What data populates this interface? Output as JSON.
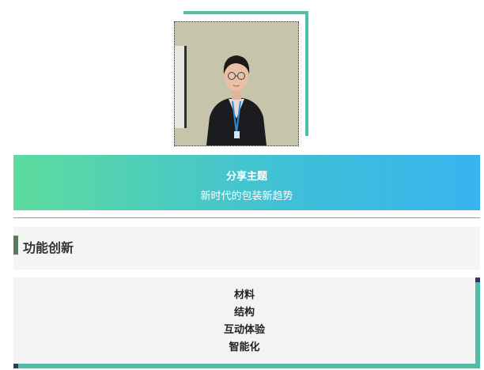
{
  "photo": {
    "alt": "speaker portrait",
    "frame_color": "#4dbfa6"
  },
  "banner": {
    "title": "分享主题",
    "subtitle": "新时代的包装新趋势",
    "gradient_start": "#5ddc9e",
    "gradient_end": "#3ab3ef"
  },
  "section": {
    "title": "功能创新",
    "bar_color": "#5b7a5c"
  },
  "topics": {
    "items": [
      "材料",
      "结构",
      "互动体验",
      "智能化"
    ],
    "border_color": "#4dbfa6"
  }
}
